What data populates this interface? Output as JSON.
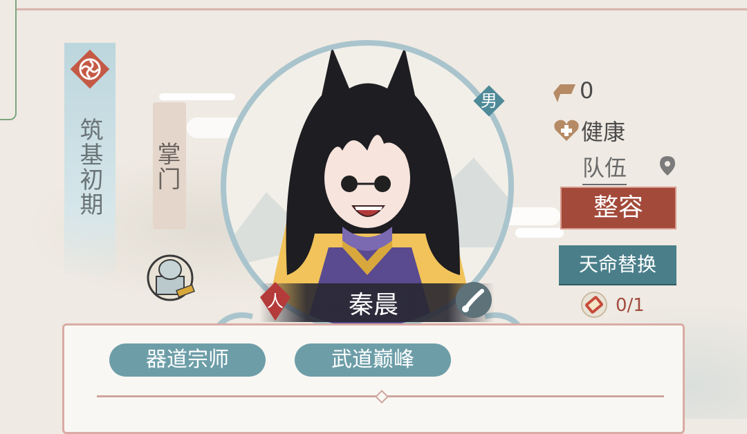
{
  "realm": {
    "label": "筑基初期"
  },
  "role": {
    "label": "掌门"
  },
  "character": {
    "name": "秦晨",
    "gender_badge": "男",
    "type_badge": "人",
    "icons": [
      "gender-badge-icon",
      "human-type-icon",
      "ink-brush-icon",
      "flower-emblem-icon",
      "stone-seal-icon"
    ]
  },
  "stats": {
    "reputation": "0",
    "health": "健康",
    "team_label": "队伍"
  },
  "actions": {
    "face_edit_label": "整容",
    "fate_swap_label": "天命替换",
    "scroll_count": "0/1"
  },
  "traits": [
    {
      "label": "器道宗师"
    },
    {
      "label": "武道巅峰"
    }
  ],
  "colors": {
    "accent_red": "#a34a3a",
    "accent_teal": "#4a7f8a",
    "panel_border": "#d9aba4"
  }
}
